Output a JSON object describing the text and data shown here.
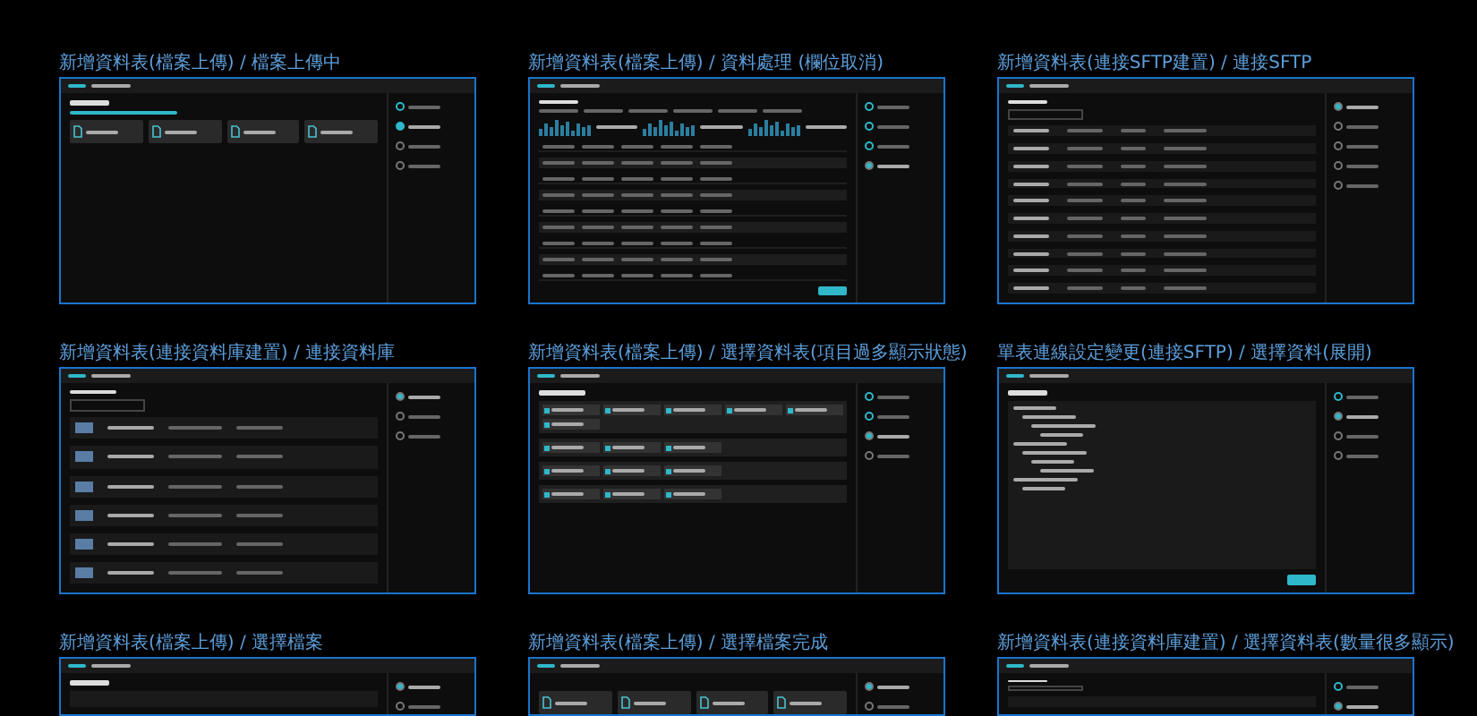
{
  "frames": [
    {
      "title": "新增資料表(檔案上傳) / 檔案上傳中",
      "kind": "upload",
      "steps": [
        {
          "done": true,
          "selected": false
        },
        {
          "done": true,
          "selected": true
        },
        {
          "done": false,
          "selected": false
        },
        {
          "done": false,
          "selected": false
        }
      ]
    },
    {
      "title": "新增資料表(檔案上傳) / 資料處理 (欄位取消)",
      "kind": "table",
      "steps": [
        {
          "done": true,
          "selected": false
        },
        {
          "done": true,
          "selected": false
        },
        {
          "done": true,
          "selected": false
        },
        {
          "done": false,
          "selected": true
        }
      ]
    },
    {
      "title": "新增資料表(連接SFTP建置) / 連接SFTP",
      "kind": "list",
      "steps": [
        {
          "done": false,
          "selected": true
        },
        {
          "done": false,
          "selected": false
        },
        {
          "done": false,
          "selected": false
        },
        {
          "done": false,
          "selected": false
        },
        {
          "done": false,
          "selected": false
        }
      ]
    },
    {
      "title": "新增資料表(連接資料庫建置) / 連接資料庫",
      "kind": "dblist",
      "steps": [
        {
          "done": false,
          "selected": true
        },
        {
          "done": false,
          "selected": false
        },
        {
          "done": false,
          "selected": false
        }
      ]
    },
    {
      "title": "新增資料表(檔案上傳) / 選擇資料表(項目過多顯示狀態)",
      "kind": "groups",
      "steps": [
        {
          "done": true,
          "selected": false
        },
        {
          "done": true,
          "selected": false
        },
        {
          "done": false,
          "selected": true
        },
        {
          "done": false,
          "selected": false
        }
      ]
    },
    {
      "title": "單表連線設定變更(連接SFTP) / 選擇資料(展開)",
      "kind": "tree",
      "steps": [
        {
          "done": true,
          "selected": false
        },
        {
          "done": false,
          "selected": true
        },
        {
          "done": false,
          "selected": false
        },
        {
          "done": false,
          "selected": false
        }
      ]
    },
    {
      "title": "新增資料表(檔案上傳) / 選擇檔案",
      "kind": "empty",
      "steps": [
        {
          "done": false,
          "selected": true
        },
        {
          "done": false,
          "selected": false
        }
      ]
    },
    {
      "title": "新增資料表(檔案上傳) / 選擇檔案完成",
      "kind": "files",
      "steps": [
        {
          "done": false,
          "selected": true
        },
        {
          "done": false,
          "selected": false
        }
      ]
    },
    {
      "title": "新增資料表(連接資料庫建置) / 選擇資料表(數量很多顯示)",
      "kind": "search",
      "steps": [
        {
          "done": true,
          "selected": false
        },
        {
          "done": false,
          "selected": true
        }
      ]
    }
  ]
}
